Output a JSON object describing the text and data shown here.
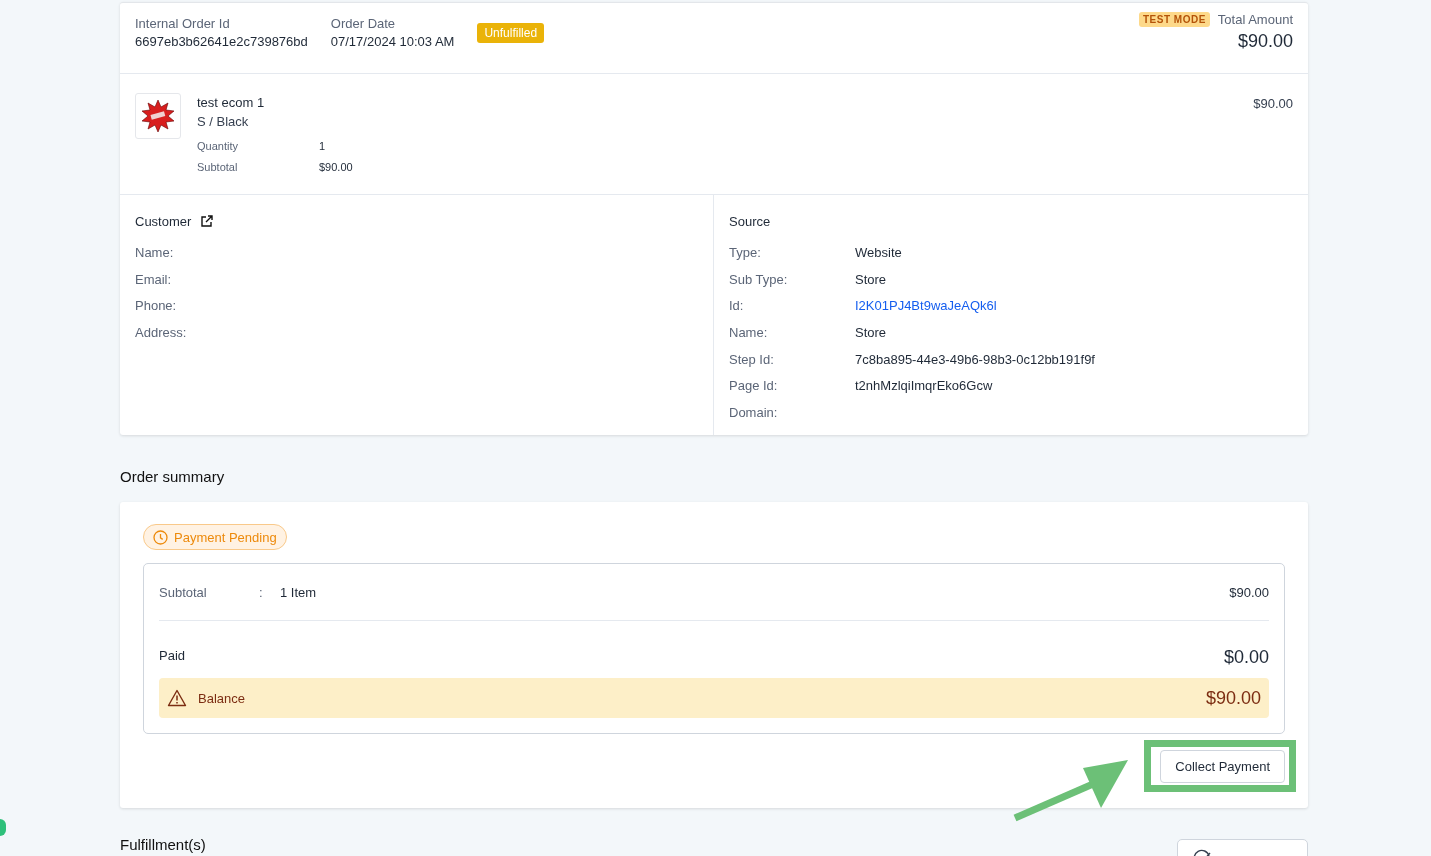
{
  "order": {
    "id_label": "Internal Order Id",
    "id": "6697eb3b62641e2c739876bd",
    "date_label": "Order Date",
    "date": "07/17/2024 10:03 AM",
    "status_badge": "Unfulfilled",
    "test_mode_badge": "TEST MODE",
    "total_label": "Total Amount",
    "total": "$90.00"
  },
  "item": {
    "name": "test ecom 1",
    "variant": "S / Black",
    "quantity_label": "Quantity",
    "quantity": "1",
    "subtotal_label": "Subtotal",
    "subtotal": "$90.00",
    "price": "$90.00"
  },
  "customer": {
    "title": "Customer",
    "fields": [
      {
        "label": "Name:"
      },
      {
        "label": "Email:"
      },
      {
        "label": "Phone:"
      },
      {
        "label": "Address:"
      }
    ]
  },
  "source": {
    "title": "Source",
    "fields": [
      {
        "label": "Type:",
        "value": "Website",
        "kind": "text"
      },
      {
        "label": "Sub Type:",
        "value": "Store",
        "kind": "text"
      },
      {
        "label": "Id:",
        "value": "I2K01PJ4Bt9waJeAQk6l",
        "kind": "link"
      },
      {
        "label": "Name:",
        "value": "Store",
        "kind": "text"
      },
      {
        "label": "Step Id:",
        "value": "7c8ba895-44e3-49b6-98b3-0c12bb191f9f",
        "kind": "text"
      },
      {
        "label": "Page Id:",
        "value": "t2nhMzlqiImqrEko6Gcw",
        "kind": "text"
      },
      {
        "label": "Domain:"
      }
    ]
  },
  "summary": {
    "heading": "Order summary",
    "status_badge": "Payment Pending",
    "subtotal_label": "Subtotal",
    "separator": ":",
    "item_count": "1 Item",
    "subtotal": "$90.00",
    "paid_label": "Paid",
    "paid": "$0.00",
    "balance_label": "Balance",
    "balance": "$90.00",
    "collect_button": "Collect Payment"
  },
  "fulfillments": {
    "heading": "Fulfillment(s)"
  }
}
